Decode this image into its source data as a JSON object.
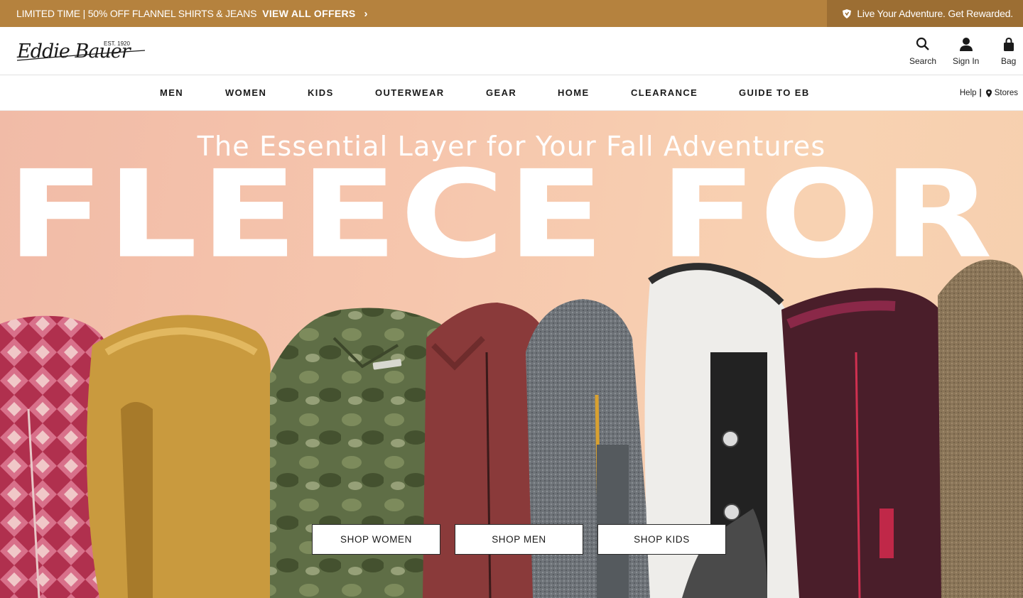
{
  "promo": {
    "left_text": "LIMITED TIME | 50% OFF FLANNEL SHIRTS & JEANS",
    "left_cta": "VIEW ALL OFFERS",
    "right_text": "Live Your Adventure. Get Rewarded.",
    "bg_color": "#b5823e",
    "right_bg_color": "#9c6e33"
  },
  "header": {
    "logo_text": "Eddie Bauer",
    "logo_est": "EST. 1920",
    "search_label": "Search",
    "signin_label": "Sign In",
    "bag_label": "Bag"
  },
  "nav": {
    "items": [
      {
        "label": "MEN"
      },
      {
        "label": "WOMEN"
      },
      {
        "label": "KIDS"
      },
      {
        "label": "OUTERWEAR"
      },
      {
        "label": "GEAR"
      },
      {
        "label": "HOME"
      },
      {
        "label": "CLEARANCE"
      },
      {
        "label": "GUIDE TO EB"
      }
    ],
    "help_label": "Help",
    "separator": "|",
    "stores_label": "Stores"
  },
  "hero": {
    "subtitle": "The Essential Layer for Your Fall Adventures",
    "title": "FLEECE FOR DAYS",
    "buttons": [
      {
        "label": "SHOP WOMEN"
      },
      {
        "label": "SHOP MEN"
      },
      {
        "label": "SHOP KIDS"
      }
    ]
  }
}
